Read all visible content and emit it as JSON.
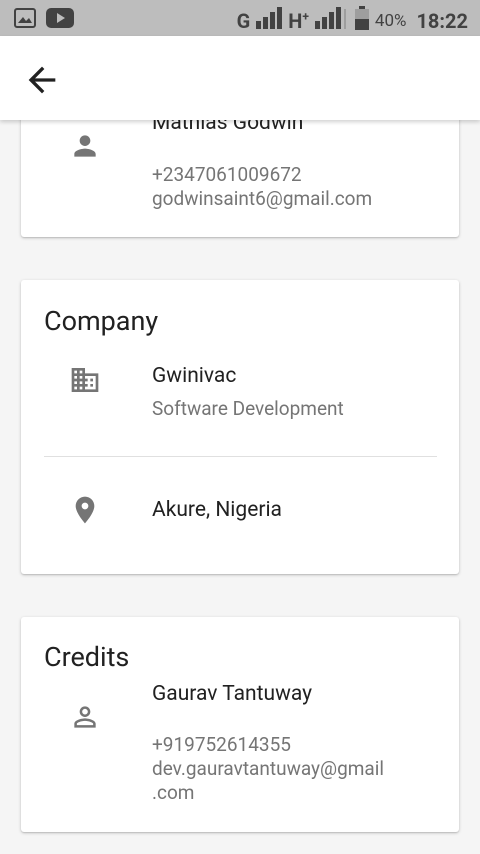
{
  "statusbar": {
    "network_g": "G",
    "network_h": "H",
    "network_h_sup": "+",
    "battery": "40%",
    "time": "18:22",
    "icons": [
      "image-icon",
      "youtube-icon",
      "signal-icon",
      "battery-icon"
    ]
  },
  "appbar": {
    "back_icon": "arrow-back-icon"
  },
  "owner_card": {
    "name": "Mathias Godwin",
    "phone": "+2347061009672",
    "email": "godwinsaint6@gmail.com",
    "icon": "person-icon"
  },
  "company_card": {
    "title": "Company",
    "company_name": "Gwinivac",
    "company_type": "Software Development",
    "location": "Akure, Nigeria",
    "icons": [
      "business-icon",
      "location-pin-icon"
    ]
  },
  "credits_card": {
    "title": "Credits",
    "name": "Gaurav Tantuway",
    "phone": "+919752614355",
    "email_line1": "dev.gauravtantuway@gmail",
    "email_line2": ".com",
    "icon": "person-outline-icon"
  },
  "colors": {
    "background": "#f5f5f5",
    "card": "#ffffff",
    "status_bar": "#bdbdbd",
    "icon": "#757575",
    "text_primary": "#212121",
    "text_secondary": "#757575"
  }
}
